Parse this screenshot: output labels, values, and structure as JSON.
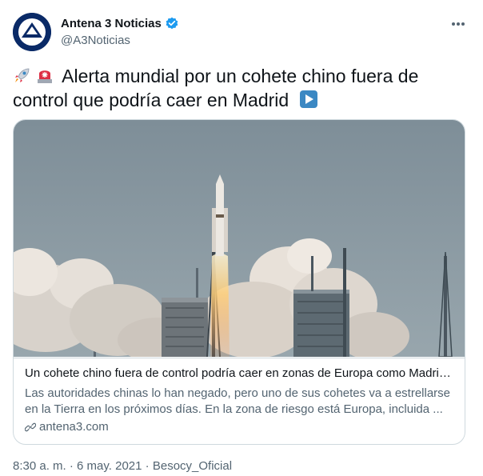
{
  "account": {
    "name": "Antena 3 Noticias",
    "handle": "@A3Noticias"
  },
  "tweet": {
    "text": "Alerta mundial por un cohete chino fuera de control que podría caer en Madrid",
    "emojis": [
      "rocket-emoji",
      "police-light-emoji",
      "play-button-emoji"
    ]
  },
  "card": {
    "title": "Un cohete chino fuera de control podría caer en zonas de Europa como Madrid ...",
    "description": "Las autoridades chinas lo han negado, pero uno de sus cohetes va a estrellarse en la Tierra en los próximos días. En la zona de riesgo está Europa, incluida ...",
    "domain": "antena3.com"
  },
  "meta": {
    "time": "8:30 a. m.",
    "date": "6 may. 2021",
    "source": "Besocy_Oficial",
    "separator": "·"
  },
  "colors": {
    "text_primary": "#0f1419",
    "text_secondary": "#536471",
    "verified_blue": "#1d9bf0",
    "border": "#cfd9de",
    "avatar_bg": "#0a2a67"
  }
}
